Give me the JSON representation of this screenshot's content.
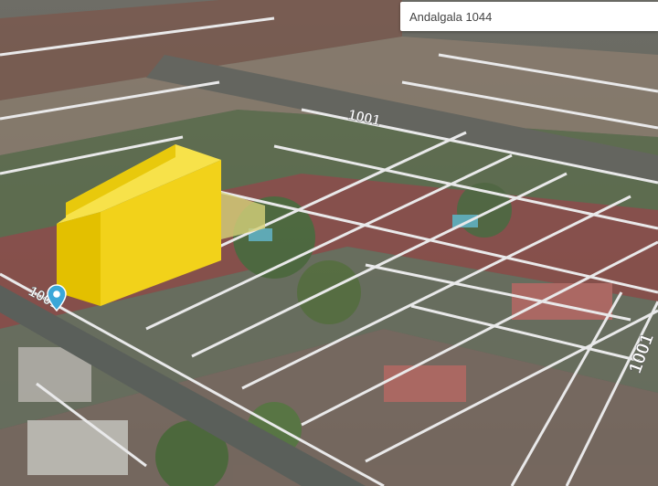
{
  "search": {
    "value": "Andalgala 1044"
  },
  "map": {
    "street_labels": [
      "1001",
      "1001",
      "1001"
    ],
    "building_color": "#f2d21a",
    "parcel_line_color": "#e9e9ea",
    "pin_color": "#3aa7d8",
    "pin_icon": "location-pin-icon"
  }
}
